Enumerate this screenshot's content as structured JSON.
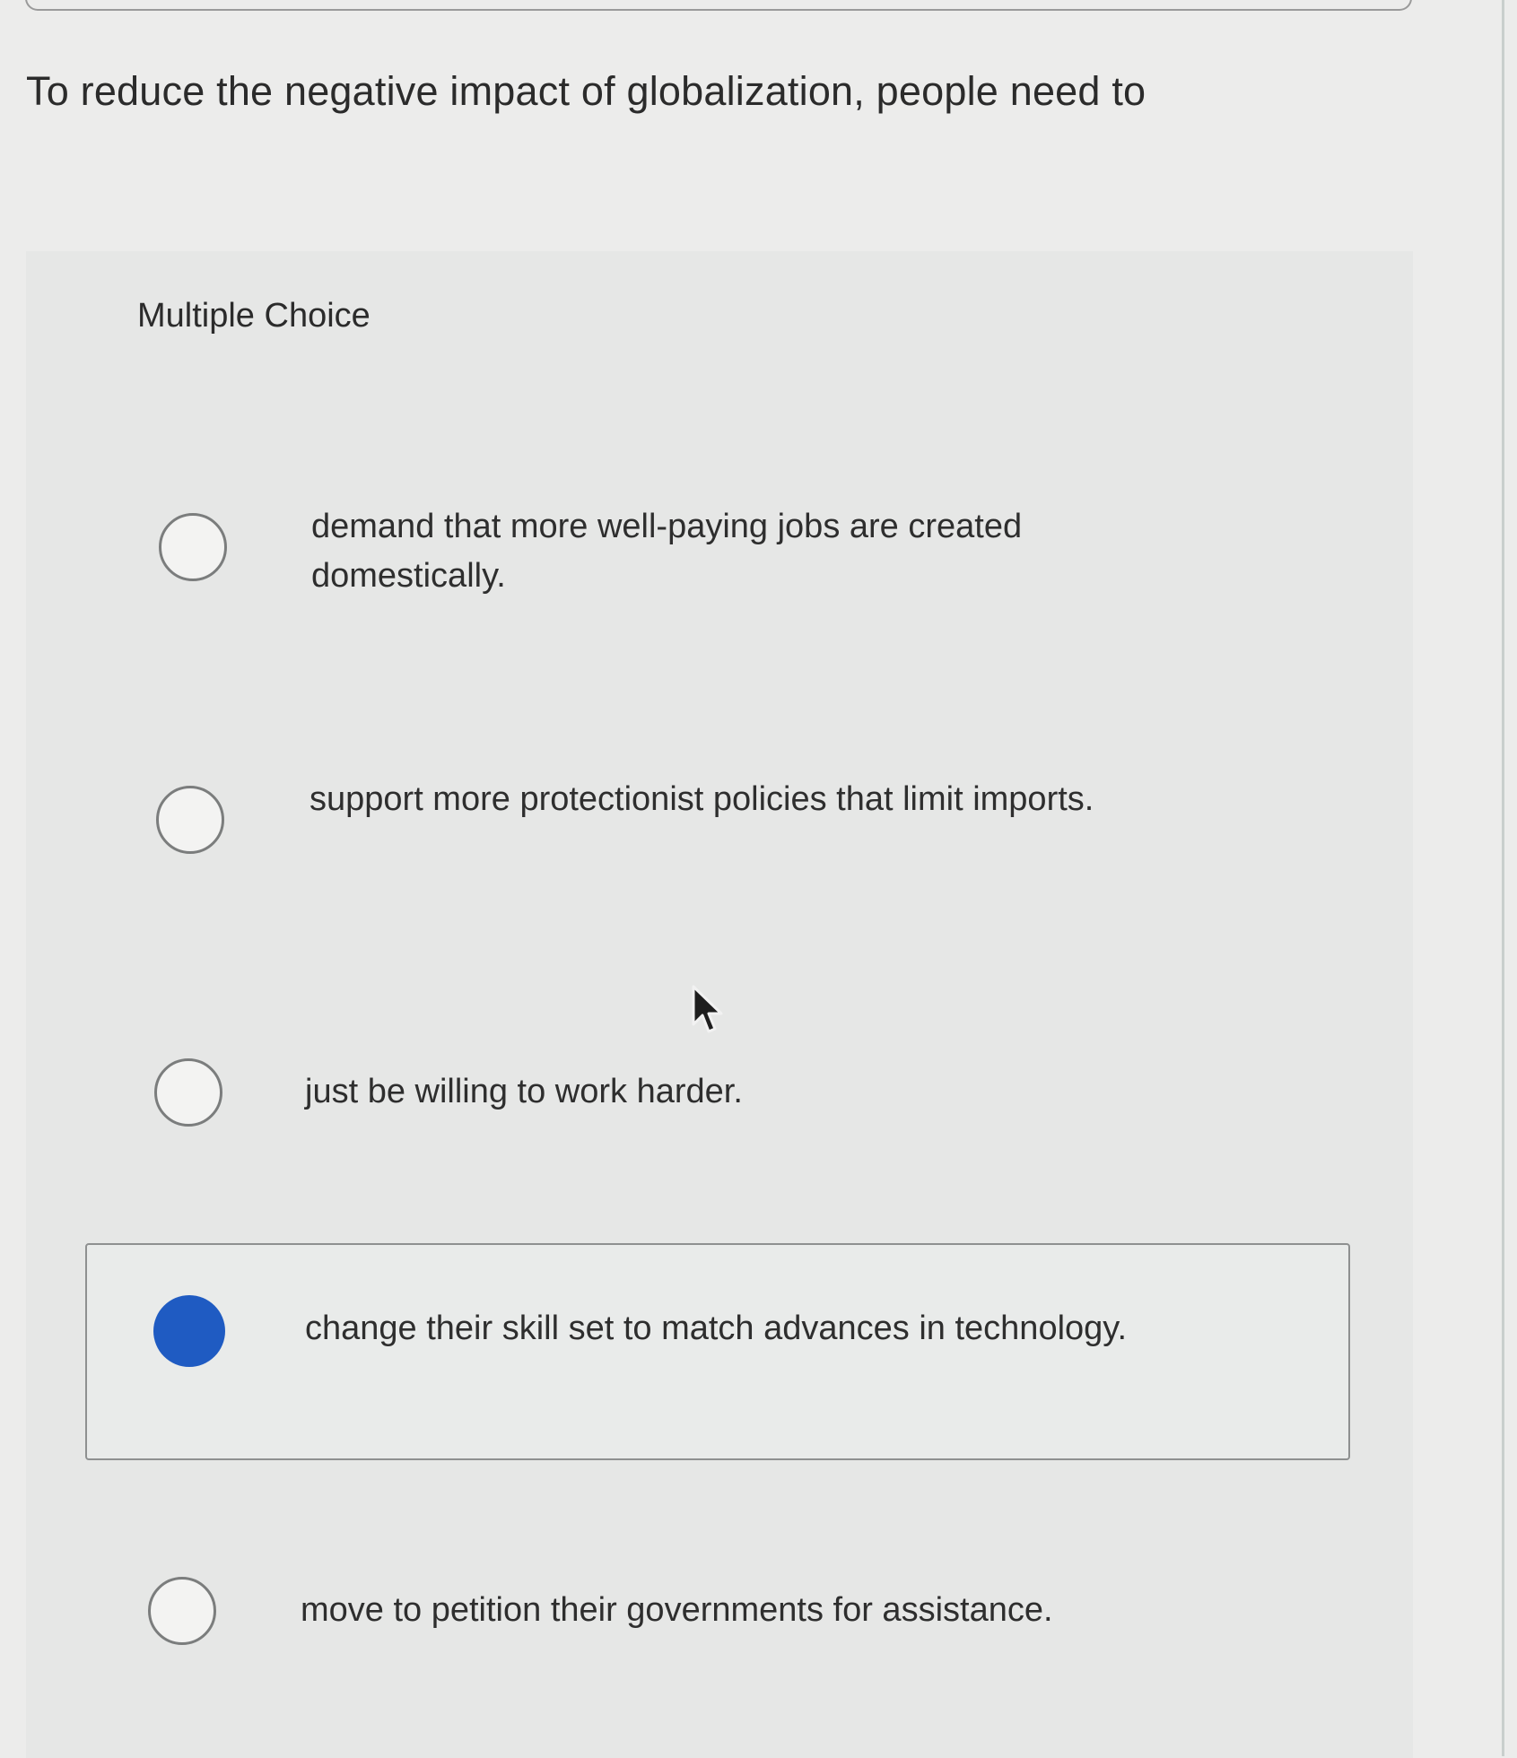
{
  "question": {
    "text": "To reduce the negative impact of globalization, people need to"
  },
  "question_type": "Multiple Choice",
  "options": [
    {
      "text": "demand that more well-paying jobs are created domestically.",
      "selected": false
    },
    {
      "text": "support more protectionist policies that limit imports.",
      "selected": false
    },
    {
      "text": "just be willing to work harder.",
      "selected": false
    },
    {
      "text": "change their skill set to match advances in technology.",
      "selected": true
    },
    {
      "text": "move to petition their governments for assistance.",
      "selected": false
    }
  ],
  "colors": {
    "selected_radio": "#1f5bc2",
    "background": "#ececeb"
  },
  "icons": {
    "cursor": "mouse-pointer-icon"
  }
}
